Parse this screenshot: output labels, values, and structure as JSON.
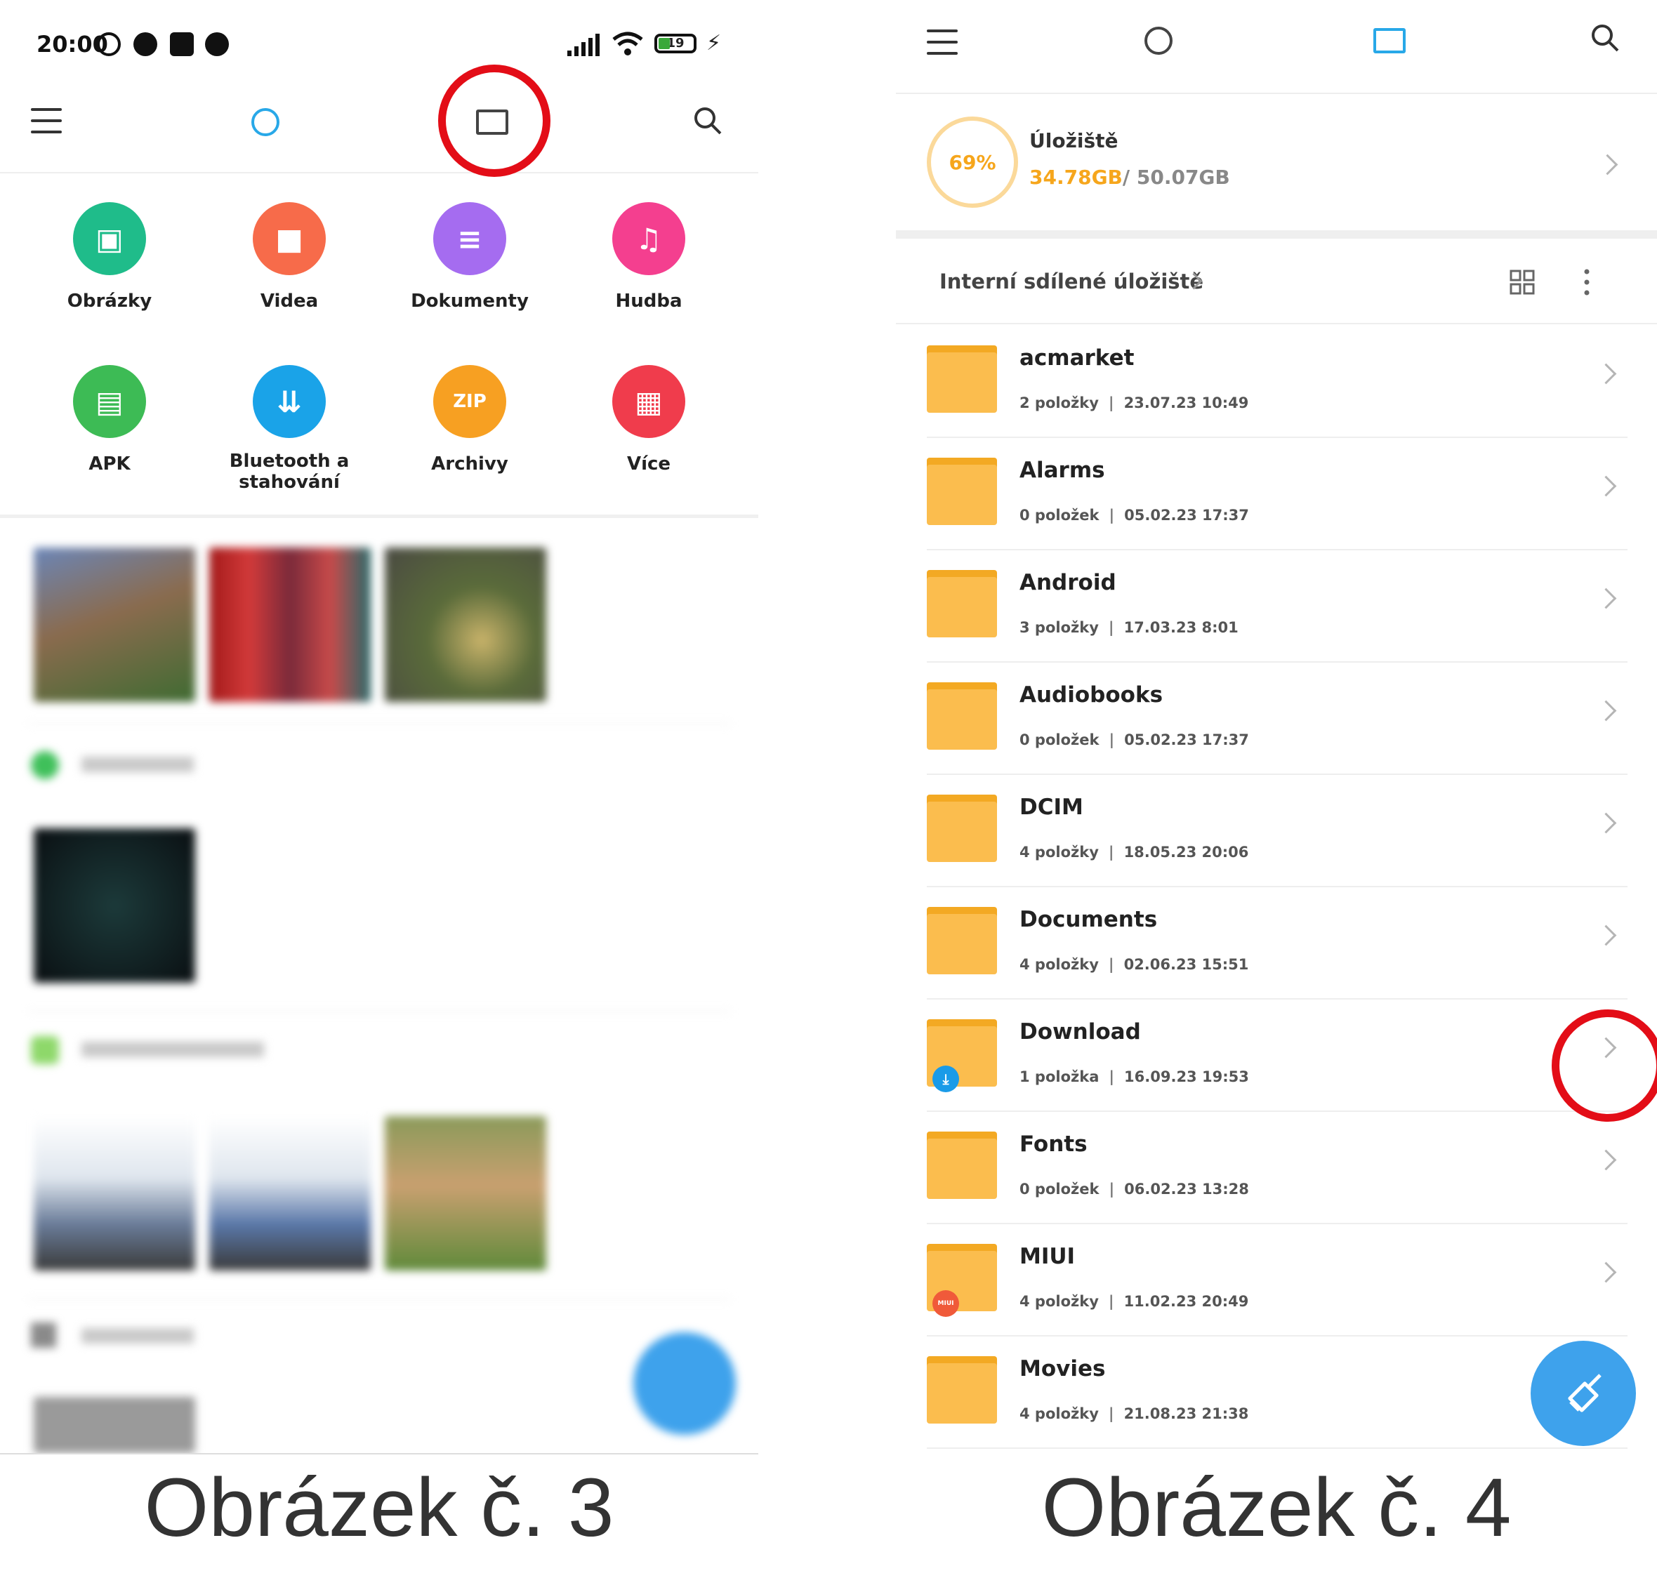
{
  "left": {
    "status": {
      "time": "20:00",
      "battery": "19"
    },
    "categories": [
      {
        "label": "Obrázky",
        "color": "#1fbc8a",
        "icon": "image-icon",
        "glyph": "▣"
      },
      {
        "label": "Videa",
        "color": "#f76b4a",
        "icon": "video-icon",
        "glyph": "■"
      },
      {
        "label": "Dokumenty",
        "color": "#a56cf0",
        "icon": "document-icon",
        "glyph": "≡"
      },
      {
        "label": "Hudba",
        "color": "#f43f8f",
        "icon": "music-icon",
        "glyph": "♫"
      },
      {
        "label": "APK",
        "color": "#3dbb55",
        "icon": "android-icon",
        "glyph": "▤"
      },
      {
        "label": "Bluetooth a\nstahování",
        "color": "#1aa3e8",
        "icon": "download-icon",
        "glyph": "⇊"
      },
      {
        "label": "Archivy",
        "color": "#f7a022",
        "icon": "zip-icon",
        "glyph": "ZIP"
      },
      {
        "label": "Více",
        "color": "#f03c4c",
        "icon": "more-grid-icon",
        "glyph": "▦"
      }
    ],
    "caption": "Obrázek č. 3"
  },
  "right": {
    "storage": {
      "percent": "69%",
      "title": "Úložiště",
      "used": "34.78GB",
      "total": "/ 50.07GB"
    },
    "breadcrumb": "Interní sdílené úložiště",
    "folders": [
      {
        "name": "acmarket",
        "count": "2 položky",
        "date": "23.07.23 10:49"
      },
      {
        "name": "Alarms",
        "count": "0 položek",
        "date": "05.02.23 17:37"
      },
      {
        "name": "Android",
        "count": "3 položky",
        "date": "17.03.23 8:01"
      },
      {
        "name": "Audiobooks",
        "count": "0 položek",
        "date": "05.02.23 17:37"
      },
      {
        "name": "DCIM",
        "count": "4 položky",
        "date": "18.05.23 20:06"
      },
      {
        "name": "Documents",
        "count": "4 položky",
        "date": "02.06.23 15:51"
      },
      {
        "name": "Download",
        "count": "1 položka",
        "date": "16.09.23 19:53"
      },
      {
        "name": "Fonts",
        "count": "0 položek",
        "date": "06.02.23 13:28"
      },
      {
        "name": "MIUI",
        "count": "4 položky",
        "date": "11.02.23 20:49"
      },
      {
        "name": "Movies",
        "count": "4 položky",
        "date": "21.08.23 21:38"
      }
    ],
    "miui_badge": "MIUI",
    "caption": "Obrázek č. 4"
  },
  "colors": {
    "accent": "#28a8e8",
    "highlight": "#e30d17",
    "folder": "#fbbd4e",
    "storage": "#f6a61c",
    "fab": "#3ea2ec"
  }
}
